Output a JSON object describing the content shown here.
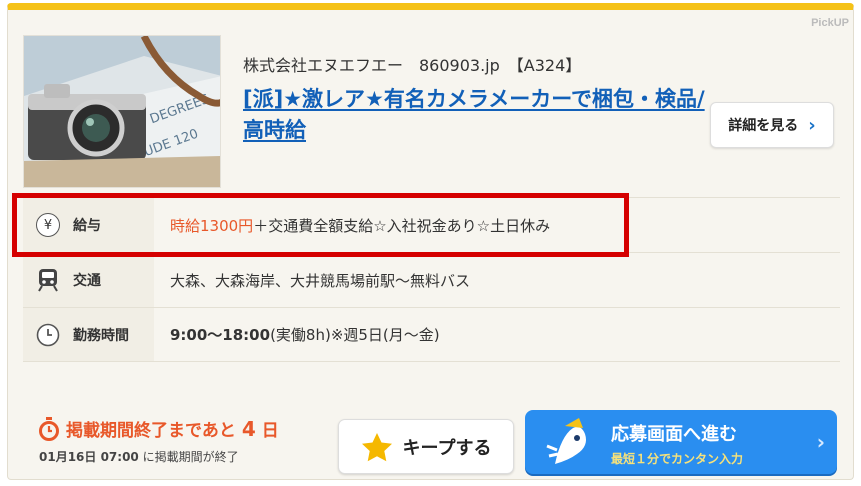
{
  "card": {
    "pickup_label": "PickUP",
    "company_line": "株式会社エヌエフエー　860903.jp　【A324】",
    "title": "[派]★激レア★有名カメラメーカーで梱包・検品/高時給",
    "detail_button": "詳細を見る"
  },
  "rows": [
    {
      "icon": "yen-icon",
      "icon_glyph": "¥",
      "label": "給与",
      "value_highlight": "時給1300円",
      "value_rest": "＋交通費全額支給☆入社祝金あり☆土日休み"
    },
    {
      "icon": "train-icon",
      "label": "交通",
      "value": "大森、大森海岸、大井競馬場前駅～無料バス"
    },
    {
      "icon": "clock-icon",
      "label": "勤務時間",
      "value_bold": "9:00～18:00",
      "value_rest": "(実働8h)※週5日(月～金)"
    }
  ],
  "footer": {
    "deadline_text": "掲載期間終了まであと",
    "deadline_days": "4",
    "deadline_unit": "日",
    "deadline_date": "01月16日 07:00",
    "deadline_suffix": "に掲載期間が終了",
    "keep_button": "キープする",
    "apply_main": "応募画面へ進む",
    "apply_sub": "最短１分でカンタン入力"
  },
  "colors": {
    "accent": "#f5c218",
    "link": "#1260b8",
    "salary": "#e8582a",
    "apply": "#2a8ef0",
    "highlight_box": "#d50000"
  }
}
